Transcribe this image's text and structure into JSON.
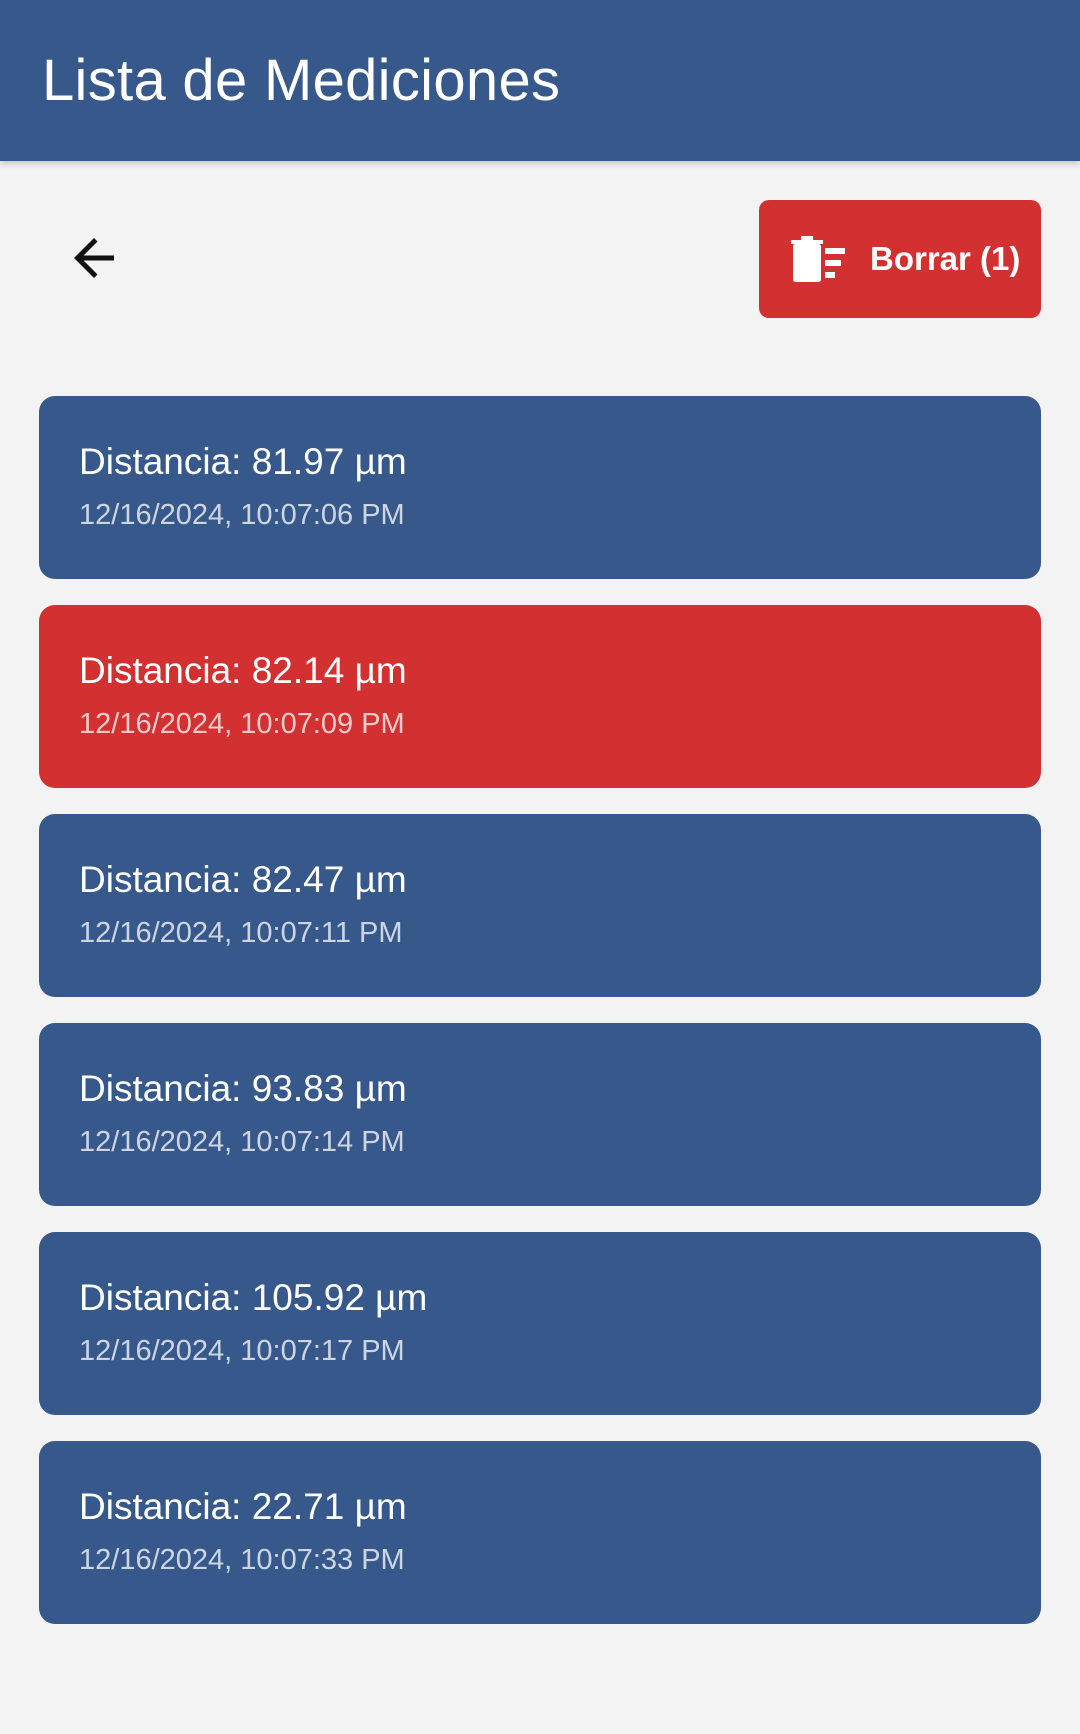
{
  "header": {
    "title": "Lista de Mediciones"
  },
  "toolbar": {
    "back_icon": "arrow-left-icon",
    "delete_icon": "delete-sweep-icon",
    "delete_label": "Borrar (1)"
  },
  "colors": {
    "primary": "#37588b",
    "danger": "#d33131",
    "background": "#f3f3f3"
  },
  "measurements": [
    {
      "distance": "Distancia: 81.97 µm",
      "time": "12/16/2024, 10:07:06 PM",
      "selected": false
    },
    {
      "distance": "Distancia: 82.14 µm",
      "time": "12/16/2024, 10:07:09 PM",
      "selected": true
    },
    {
      "distance": "Distancia: 82.47 µm",
      "time": "12/16/2024, 10:07:11 PM",
      "selected": false
    },
    {
      "distance": "Distancia: 93.83 µm",
      "time": "12/16/2024, 10:07:14 PM",
      "selected": false
    },
    {
      "distance": "Distancia: 105.92 µm",
      "time": "12/16/2024, 10:07:17 PM",
      "selected": false
    },
    {
      "distance": "Distancia: 22.71 µm",
      "time": "12/16/2024, 10:07:33 PM",
      "selected": false
    }
  ]
}
